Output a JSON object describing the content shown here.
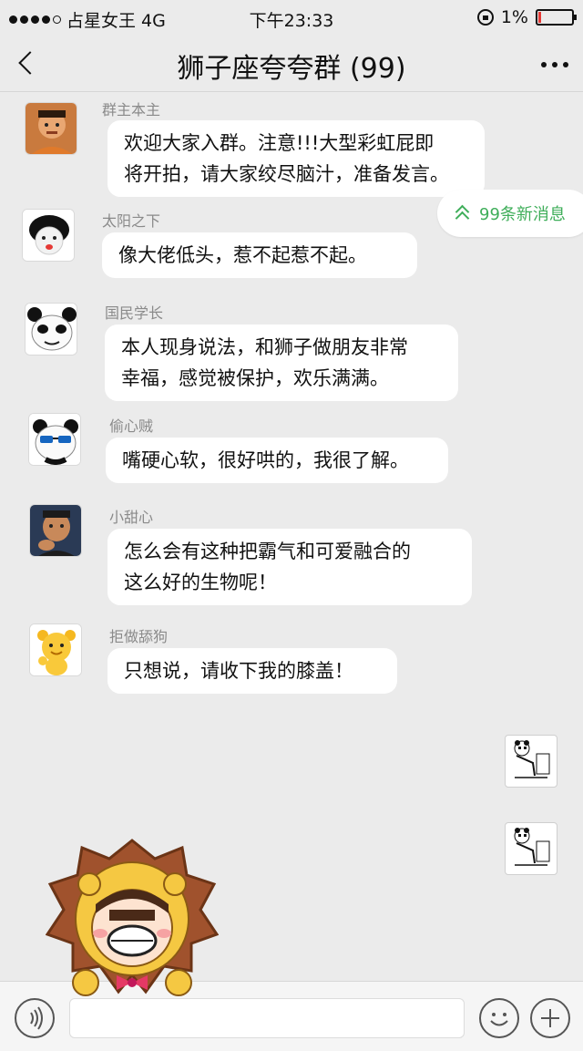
{
  "status_bar": {
    "carrier": "占星女王 4G",
    "time": "下午23:33",
    "battery": "1%",
    "battery_level_percent": 1,
    "signal_bars_filled": 4,
    "signal_bars_total": 5
  },
  "nav": {
    "title": "狮子座夸夸群",
    "member_count": "(99)"
  },
  "new_messages_pill": {
    "label": "99条新消息",
    "color": "#3fae5a"
  },
  "messages": [
    {
      "sender": "群主本主",
      "text": "欢迎大家入群。注意!!!大型彩虹屁即\n将开拍，请大家绞尽脑汁，准备发言。",
      "avatar_icon": "chubby-man-avatar"
    },
    {
      "sender": "太阳之下",
      "text": "像大佬低头，惹不起惹不起。",
      "avatar_icon": "lipstick-girl-avatar"
    },
    {
      "sender": "国民学长",
      "text": "本人现身说法，和狮子做朋友非常\n幸福，感觉被保护，欢乐满满。",
      "avatar_icon": "panda-face-avatar"
    },
    {
      "sender": "偷心贼",
      "text": "嘴硬心软，很好哄的，我很了解。",
      "avatar_icon": "sunglasses-panda-avatar"
    },
    {
      "sender": "小甜心",
      "text": "怎么会有这种把霸气和可爱融合的\n这么好的生物呢！",
      "avatar_icon": "thinking-man-avatar"
    },
    {
      "sender": "拒做舔狗",
      "text": "只想说，请收下我的膝盖！",
      "avatar_icon": "yellow-bear-avatar"
    }
  ],
  "own_stickers": [
    {
      "icon": "kneeling-panda-sticker"
    },
    {
      "icon": "kneeling-panda-sticker"
    }
  ],
  "input_bar": {
    "placeholder": ""
  }
}
